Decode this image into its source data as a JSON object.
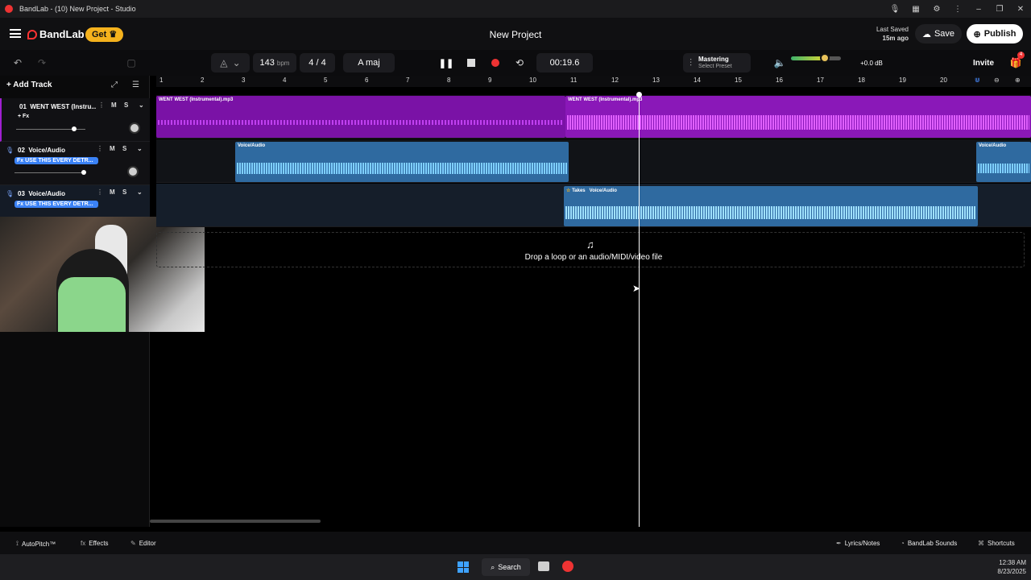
{
  "window": {
    "title": "BandLab - (10) New Project - Studio"
  },
  "header": {
    "brand": "BandLab",
    "get_label": "Get",
    "project_title": "New Project",
    "last_saved_label": "Last Saved",
    "last_saved_value": "15m ago",
    "save_label": "Save",
    "publish_label": "Publish"
  },
  "toolbar": {
    "tempo": "143",
    "tempo_unit": "bpm",
    "time_signature": "4 / 4",
    "key": "A maj",
    "time": "00:19.6",
    "mastering_label": "Mastering",
    "mastering_preset": "Select Preset",
    "volume_db": "+0.0 dB",
    "volume_level": 0.6,
    "invite_label": "Invite",
    "notification_count": "4"
  },
  "tracks": {
    "add_track_label": "Add Track",
    "items": [
      {
        "number": "01",
        "name": "WENT WEST (Instru...",
        "fx": "+ Fx",
        "mute": "M",
        "solo": "S"
      },
      {
        "number": "02",
        "name": "Voice/Audio",
        "fx": "Fx USE THIS EVERY DETR...",
        "mute": "M",
        "solo": "S"
      },
      {
        "number": "03",
        "name": "Voice/Audio",
        "fx": "Fx USE THIS EVERY DETR...",
        "mute": "M",
        "solo": "S"
      }
    ]
  },
  "ruler": {
    "bars": [
      "1",
      "2",
      "3",
      "4",
      "5",
      "6",
      "7",
      "8",
      "9",
      "10",
      "11",
      "12",
      "13",
      "14",
      "15",
      "16",
      "17",
      "18",
      "19",
      "20"
    ]
  },
  "clips": {
    "track1_a": "WENT WEST (Instrumental).mp3",
    "track1_b": "WENT WEST (Instrumental).mp3",
    "track2_a": "Voice/Audio",
    "track2_b": "Voice/Audio",
    "track3_takes": "Takes",
    "track3_a": "Voice/Audio"
  },
  "drop_zone": {
    "text": "Drop a loop or an audio/MIDI/video file"
  },
  "bottom_bar": {
    "autopitch": "AutoPitch™",
    "effects": "Effects",
    "editor": "Editor",
    "lyrics": "Lyrics/Notes",
    "sounds": "BandLab Sounds",
    "shortcuts": "Shortcuts"
  },
  "taskbar": {
    "search": "Search",
    "time": "12:38 AM",
    "date": "8/23/2025"
  },
  "colors": {
    "instrumental_clip": "#8a18b8",
    "voice_clip": "#2f6aa0",
    "accent_red": "#e33333",
    "brand_yellow": "#f5b21d"
  }
}
